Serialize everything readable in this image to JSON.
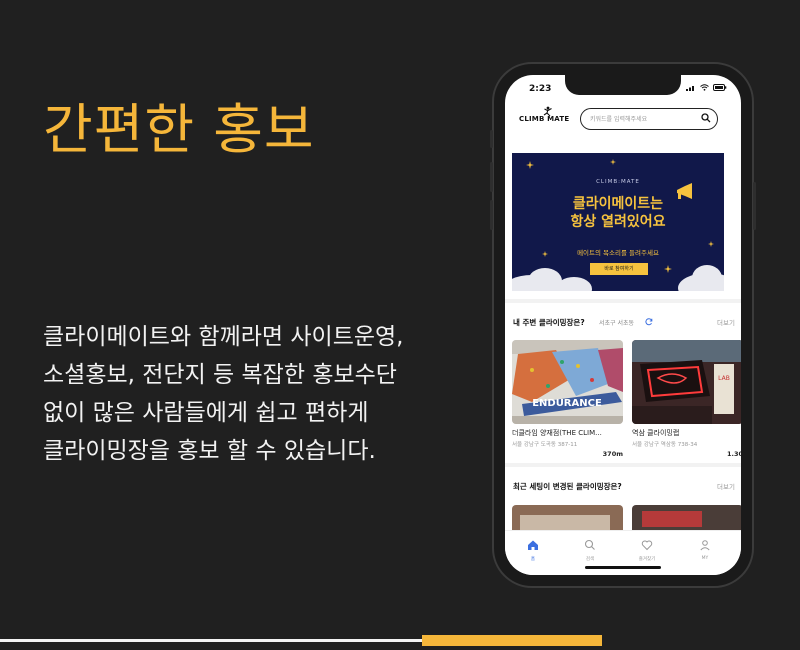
{
  "headline": "간편한 홍보",
  "description": [
    "클라이메이트와 함께라면 사이트운영,",
    "소셜홍보, 전단지 등 복잡한 홍보수단",
    "없이 많은 사람들에게 쉽고 편하게",
    "클라이밍장을 홍보 할 수 있습니다."
  ],
  "phone": {
    "time": "2:23",
    "logo": "CLIMB MATE",
    "search_placeholder": "키워드를 입력해주세요",
    "banner": {
      "brand": "CLIMB:MATE",
      "title_line1": "클라이메이트는",
      "title_line2": "항상 열려있어요",
      "subtitle": "메이트의 목소리를 들려주세요",
      "button": "바로 참여하기"
    },
    "nearby": {
      "title": "내 주변 클라이밍장은?",
      "location": "서초구 서초동",
      "more": "더보기",
      "gyms": [
        {
          "name": "더클라임 양재점(THE CLIM...",
          "addr": "서울 강남구 도곡동 387-11",
          "distance": "370m"
        },
        {
          "name": "역삼 클라이밍랩",
          "addr": "서울 강남구 역삼동 738-34",
          "distance": "1.30"
        }
      ]
    },
    "recent": {
      "title": "최근 세팅이 변경된 클라이밍장은?",
      "more": "더보기"
    },
    "tabs": [
      {
        "label": "홈",
        "icon": "home-icon"
      },
      {
        "label": "검색",
        "icon": "search-icon"
      },
      {
        "label": "즐겨찾기",
        "icon": "heart-icon"
      },
      {
        "label": "MY",
        "icon": "person-icon"
      }
    ],
    "colors": {
      "accent": "#3b6fe0",
      "banner_bg": "#11184a",
      "banner_text": "#f6c23e"
    }
  },
  "colors": {
    "headline": "#f5b63a",
    "background": "#202020"
  }
}
